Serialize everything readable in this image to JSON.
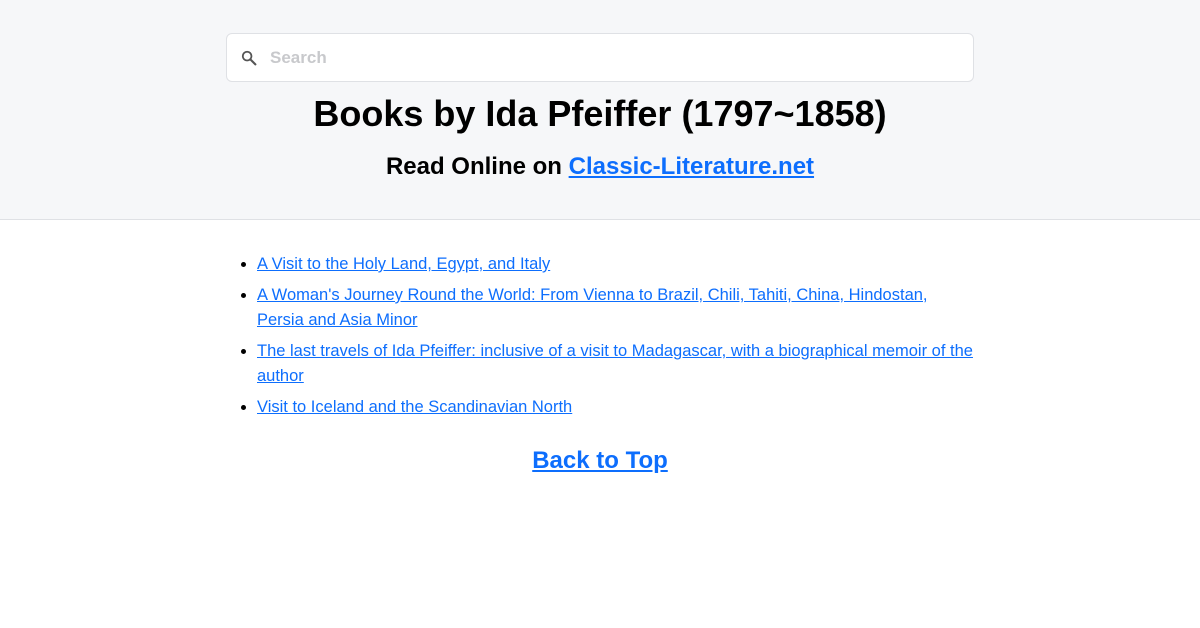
{
  "search": {
    "placeholder": "Search",
    "icon": "search-icon"
  },
  "header": {
    "title": "Books by Ida Pfeiffer (1797~1858)",
    "subtitle_prefix": "Read Online on ",
    "site_link": "Classic-Literature.net"
  },
  "books": [
    "A Visit to the Holy Land, Egypt, and Italy",
    "A Woman's Journey Round the World: From Vienna to Brazil, Chili, Tahiti, China, Hindostan, Persia and Asia Minor",
    "The last travels of Ida Pfeiffer: inclusive of a visit to Madagascar, with a biographical memoir of the author",
    "Visit to Iceland and the Scandinavian North"
  ],
  "footer": {
    "back_to_top": "Back to Top"
  },
  "colors": {
    "link": "#0d6efd",
    "header_bg": "#f6f7f9"
  }
}
